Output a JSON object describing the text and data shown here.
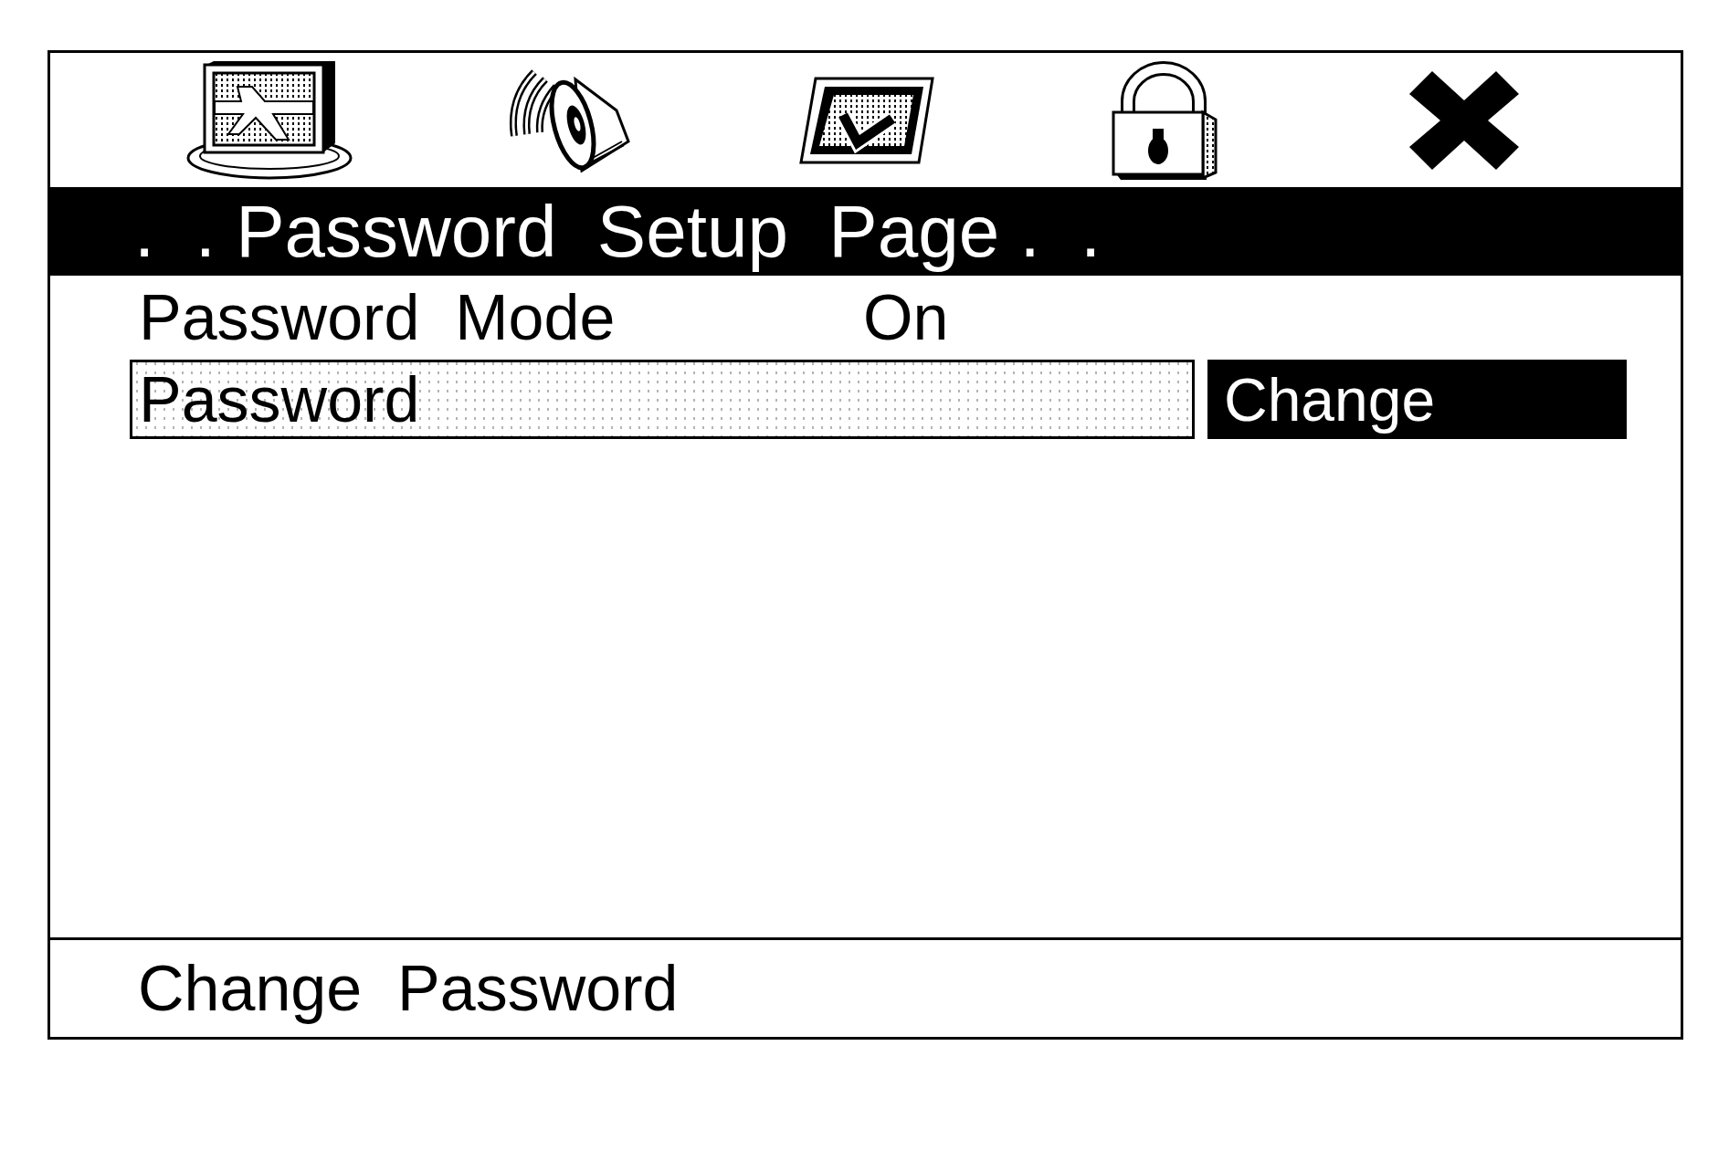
{
  "menu_bar": {
    "items": [
      {
        "kind": "monitor"
      },
      {
        "kind": "speaker"
      },
      {
        "kind": "checkmark"
      },
      {
        "kind": "lock"
      },
      {
        "kind": "close"
      }
    ]
  },
  "title_bar": {
    "title": ".  . Password  Setup  Page .  ."
  },
  "settings": [
    {
      "kind": "value",
      "label": "Password  Mode",
      "value": "On",
      "selected": false
    },
    {
      "kind": "action",
      "label": "Password",
      "button": "Change",
      "selected": true
    }
  ],
  "status_bar": {
    "text": "Change  Password"
  }
}
